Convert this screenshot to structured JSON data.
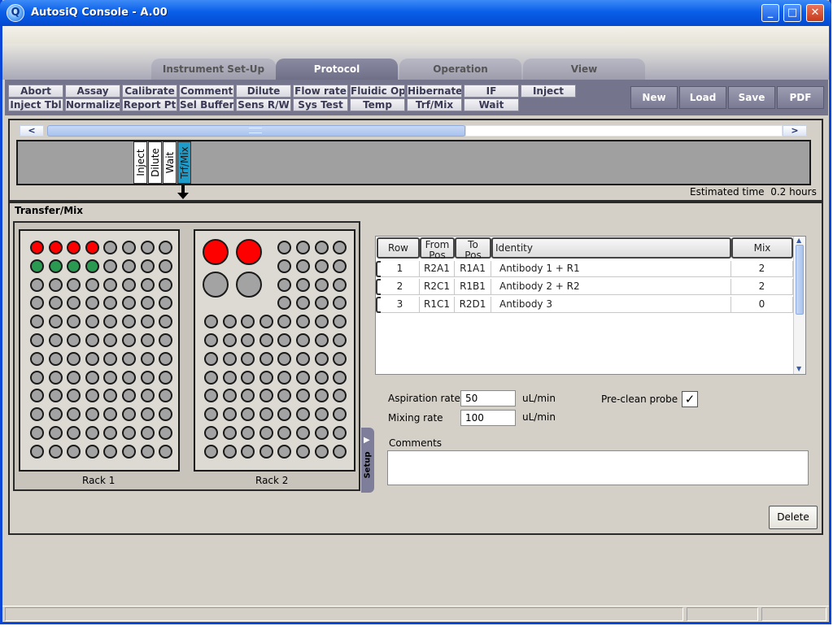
{
  "window": {
    "title": "AutosiQ Console - A.00",
    "app_icon": "Q",
    "minimize": "_",
    "maximize": "□",
    "close": "✕"
  },
  "tabs": [
    {
      "label": "Instrument Set-Up"
    },
    {
      "label": "Protocol"
    },
    {
      "label": "Operation"
    },
    {
      "label": "View"
    }
  ],
  "toolbar": {
    "row1": [
      "Abort",
      "Assay",
      "Calibrate",
      "Comment",
      "Dilute",
      "Flow rate",
      "Fluidic Op",
      "Hibernate",
      "IF",
      "Inject"
    ],
    "row2": [
      "Inject Tbl",
      "Normalize",
      "Report Pt",
      "Sel Buffer",
      "Sens R/W",
      "Sys Test",
      "Temp",
      "Trf/Mix",
      "Wait"
    ],
    "actions": [
      "New",
      "Load",
      "Save",
      "PDF"
    ]
  },
  "timeline": {
    "scroll_left": "<",
    "scroll_right": ">",
    "steps": [
      "Inject",
      "Dilute",
      "Wait",
      "Trf/Mix"
    ],
    "selected_step": "Trf/Mix",
    "estimated_time_label": "Estimated time",
    "estimated_time_value": "0.2 hours"
  },
  "detail": {
    "title": "Transfer/Mix",
    "racks": [
      {
        "label": "Rack 1",
        "red_wells": 4,
        "green_wells": 4
      },
      {
        "label": "Rack 2",
        "red_wells": 2
      }
    ],
    "setup_tab": "Setup",
    "grid": {
      "headers": {
        "row": "Row",
        "from_a": "From",
        "from_b": "Pos",
        "to_a": "To",
        "to_b": "Pos",
        "identity": "Identity",
        "mix": "Mix"
      },
      "rows": [
        {
          "row": "1",
          "from": "R2A1",
          "to": "R1A1",
          "identity": "Antibody 1 + R1",
          "mix": "2"
        },
        {
          "row": "2",
          "from": "R2C1",
          "to": "R1B1",
          "identity": "Antibody 2 + R2",
          "mix": "2"
        },
        {
          "row": "3",
          "from": "R1C1",
          "to": "R2D1",
          "identity": "Antibody 3",
          "mix": "0"
        }
      ]
    },
    "aspiration": {
      "label": "Aspiration rate",
      "value": "50",
      "unit": "uL/min"
    },
    "mixing": {
      "label": "Mixing rate",
      "value": "100",
      "unit": "uL/min"
    },
    "preclean": {
      "label": "Pre-clean probe",
      "checked": true,
      "mark": "✓"
    },
    "comments_label": "Comments",
    "delete_label": "Delete"
  },
  "colors": {
    "titlebar": "#0a5fe8",
    "selected_step": "#1e9bc8",
    "red_well": "#ff0000",
    "green_well": "#2a9a52",
    "empty_well": "#a3a3a3"
  }
}
